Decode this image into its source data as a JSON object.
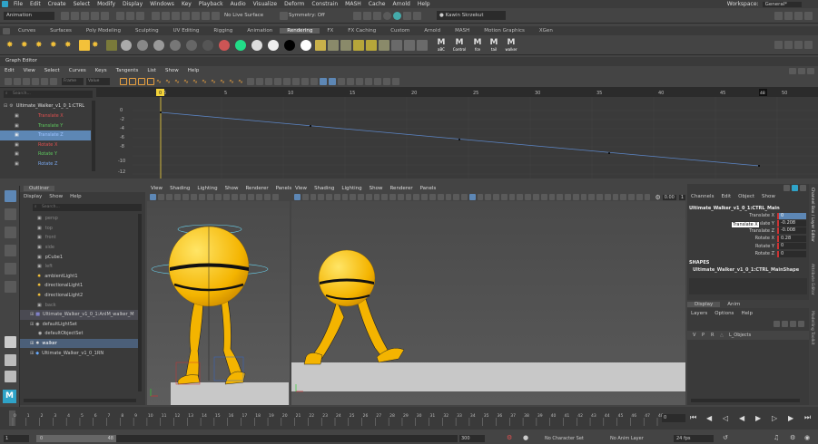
{
  "menubar": {
    "items": [
      "File",
      "Edit",
      "Create",
      "Select",
      "Modify",
      "Display",
      "Windows",
      "Key",
      "Playback",
      "Audio",
      "Visualize",
      "Deform",
      "Constrain",
      "MASH",
      "Cache",
      "Arnold",
      "Help"
    ],
    "workspace_label": "Workspace:",
    "workspace_value": "General*"
  },
  "statusline": {
    "mode": "Animation",
    "live_surface": "No Live Surface",
    "symmetry": "Symmetry: Off",
    "user": "Kawin Skrzekut"
  },
  "shelf_tabs": [
    "Curves",
    "Surfaces",
    "Poly Modeling",
    "Sculpting",
    "UV Editing",
    "Rigging",
    "Animation",
    "Rendering",
    "FX",
    "FX Caching",
    "Custom",
    "Arnold",
    "MASH",
    "Motion Graphics",
    "XGen"
  ],
  "shelf_active": "Rendering",
  "shelf_labels": [
    "aBC",
    "Control",
    "fce",
    "tail",
    "walker"
  ],
  "graph_editor": {
    "title": "Graph Editor",
    "menu": [
      "Edit",
      "View",
      "Select",
      "Curves",
      "Keys",
      "Tangents",
      "List",
      "Show",
      "Help"
    ],
    "frame_label": "Frame",
    "value_label": "Value",
    "search_placeholder": "Search...",
    "object": "Ultimate_Walker_v1_0_1:CTRL",
    "channels": [
      {
        "name": "Translate X",
        "color": "#e05050"
      },
      {
        "name": "Translate Y",
        "color": "#5ec85e"
      },
      {
        "name": "Translate Z",
        "color": "#7aa8f0"
      },
      {
        "name": "Rotate X",
        "color": "#e05050"
      },
      {
        "name": "Rotate Y",
        "color": "#5ec85e"
      },
      {
        "name": "Rotate Z",
        "color": "#7aa8f0"
      }
    ],
    "selected_channel": "Translate Z",
    "ruler": [
      "0",
      "5",
      "10",
      "15",
      "20",
      "25",
      "30",
      "35",
      "40",
      "45",
      "50"
    ],
    "current_frame": "0",
    "end_frame": "48",
    "y_ticks": [
      "0",
      "-2",
      "-4",
      "-6",
      "-8",
      "-10",
      "-12"
    ]
  },
  "outliner": {
    "title": "Outliner",
    "menu": [
      "Display",
      "Show",
      "Help"
    ],
    "search_placeholder": "Search...",
    "items": [
      {
        "label": "persp",
        "dim": true
      },
      {
        "label": "top",
        "dim": true
      },
      {
        "label": "front",
        "dim": true
      },
      {
        "label": "side",
        "dim": true
      },
      {
        "label": "pCube1",
        "dim": false
      },
      {
        "label": "left",
        "dim": true
      },
      {
        "label": "ambientLight1",
        "dim": false
      },
      {
        "label": "directionalLight1",
        "dim": false
      },
      {
        "label": "directionalLight2",
        "dim": false
      },
      {
        "label": "back",
        "dim": true
      },
      {
        "label": "Ultimate_Walker_v1_0_1:AnIM_walker_M",
        "dim": false
      },
      {
        "label": "defaultLightSet",
        "dim": false
      },
      {
        "label": "defaultObjectSet",
        "dim": false
      },
      {
        "label": "walker",
        "dim": false
      },
      {
        "label": "Ultimate_Walker_v1_0_1RN",
        "dim": false
      }
    ],
    "selected": "walker"
  },
  "viewports": {
    "menu": [
      "View",
      "Shading",
      "Lighting",
      "Show",
      "Renderer",
      "Panels"
    ],
    "value_a": "0.00",
    "value_b": "1"
  },
  "channel_box": {
    "tabs": [
      "Channels",
      "Edit",
      "Object",
      "Show"
    ],
    "object": "Ultimate_Walker_v1_0_1:CTRL_Main",
    "attrs": [
      {
        "label": "Translate X",
        "value": "0"
      },
      {
        "label": "Translate Y",
        "value": "-0.208"
      },
      {
        "label": "Translate Z",
        "value": "-0.008"
      },
      {
        "label": "Rotate X",
        "value": "0.28"
      },
      {
        "label": "Rotate Y",
        "value": "0"
      },
      {
        "label": "Rotate Z",
        "value": "0"
      }
    ],
    "tooltip": "Translate X",
    "shapes_label": "SHAPES",
    "shape": "Ultimate_Walker_v1_0_1:CTRL_MainShape",
    "layer_tabs": [
      "Display",
      "Anim"
    ],
    "layer_menu": [
      "Layers",
      "Options",
      "Help"
    ],
    "layer_vpr": [
      "V",
      "P",
      "R"
    ],
    "layer_name": "L_Objects",
    "side_tabs": [
      "Channel Box / Layer Editor",
      "Attribute Editor",
      "Modelling Toolkit"
    ]
  },
  "timeline": {
    "ticks": [
      "0",
      "1",
      "2",
      "3",
      "4",
      "5",
      "6",
      "7",
      "8",
      "9",
      "10",
      "11",
      "12",
      "13",
      "14",
      "15",
      "16",
      "17",
      "18",
      "19",
      "20",
      "21",
      "22",
      "23",
      "24",
      "25",
      "26",
      "27",
      "28",
      "29",
      "30",
      "31",
      "32",
      "33",
      "34",
      "35",
      "36",
      "37",
      "38",
      "39",
      "40",
      "41",
      "42",
      "43",
      "44",
      "45",
      "46",
      "47",
      "48"
    ],
    "current_frame": "0"
  },
  "range": {
    "start": "1",
    "inner_start": "0",
    "inner_end": "48",
    "end": "300",
    "character_set": "No Character Set",
    "anim_layer": "No Anim Layer",
    "fps": "24 fps"
  }
}
